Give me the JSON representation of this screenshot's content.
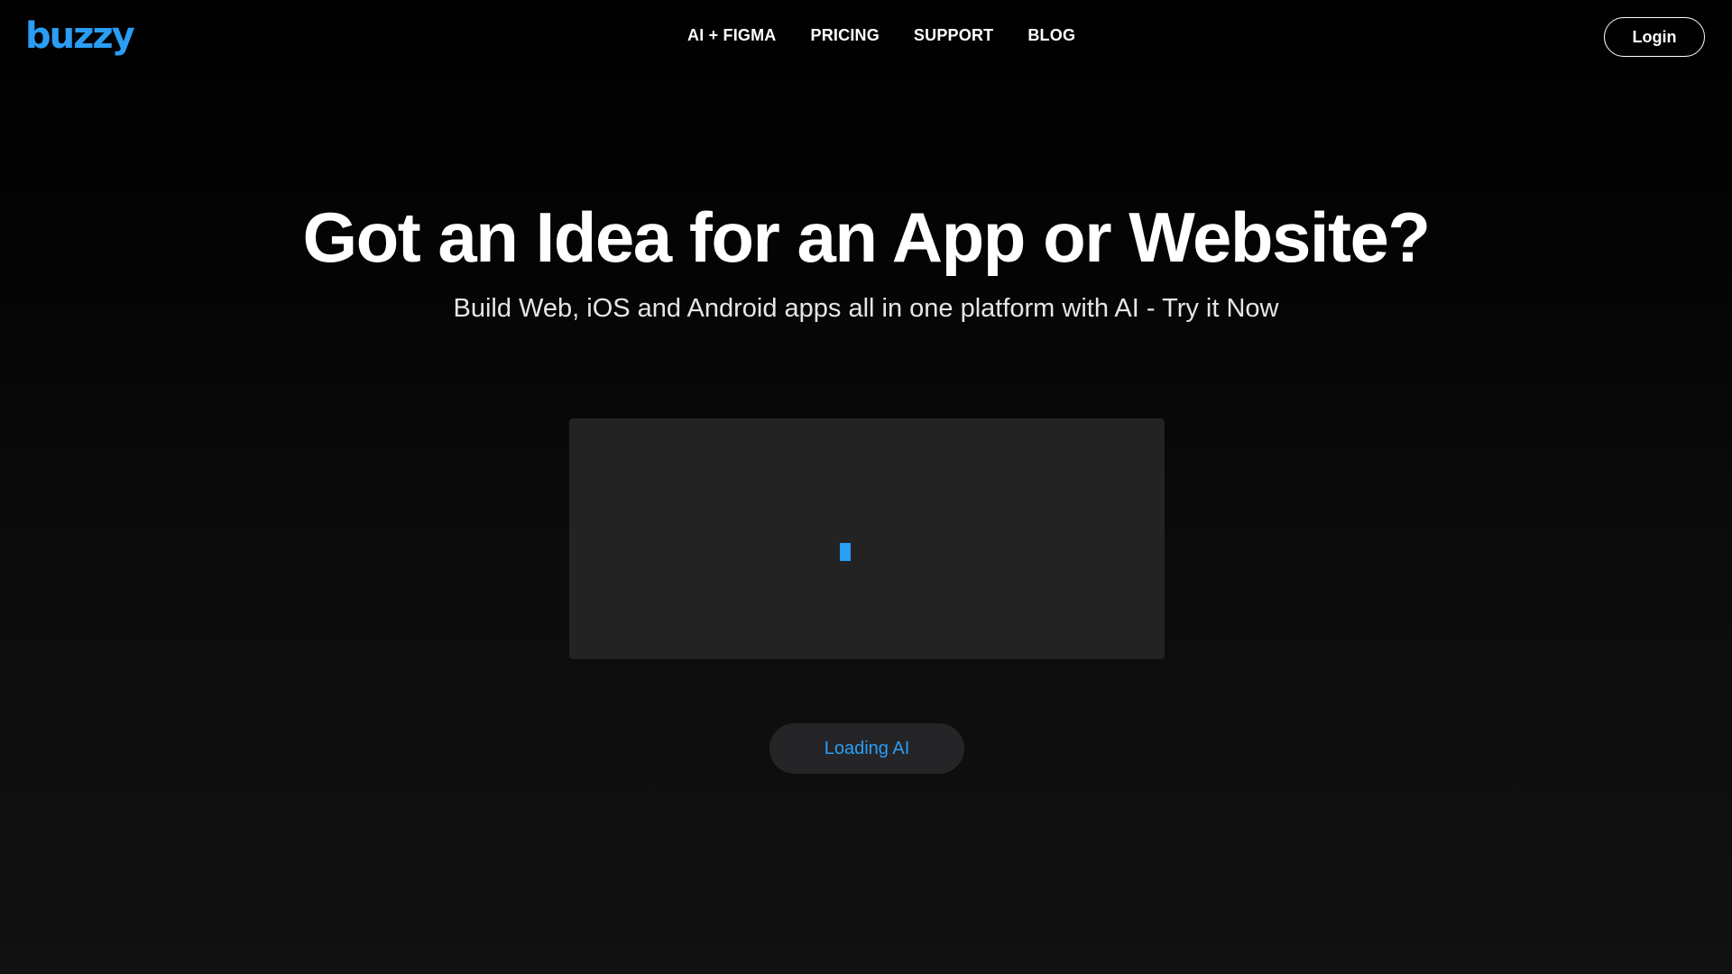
{
  "header": {
    "logo_text": "buzzy",
    "nav": [
      {
        "label": "AI + FIGMA"
      },
      {
        "label": "PRICING"
      },
      {
        "label": "SUPPORT"
      },
      {
        "label": "BLOG"
      }
    ],
    "login_label": "Login"
  },
  "hero": {
    "title": "Got an Idea for an App or Website?",
    "subtitle": "Build Web, iOS and Android apps all in one platform with AI - Try it Now"
  },
  "ai_panel": {
    "status_label": "Loading AI"
  },
  "colors": {
    "brand_blue": "#2a9df4",
    "panel_bg": "#232324",
    "pill_bg": "#252527",
    "text_white": "#ffffff"
  },
  "icons": {
    "logo": "buzzy-logo",
    "caret": "text-cursor-caret"
  }
}
